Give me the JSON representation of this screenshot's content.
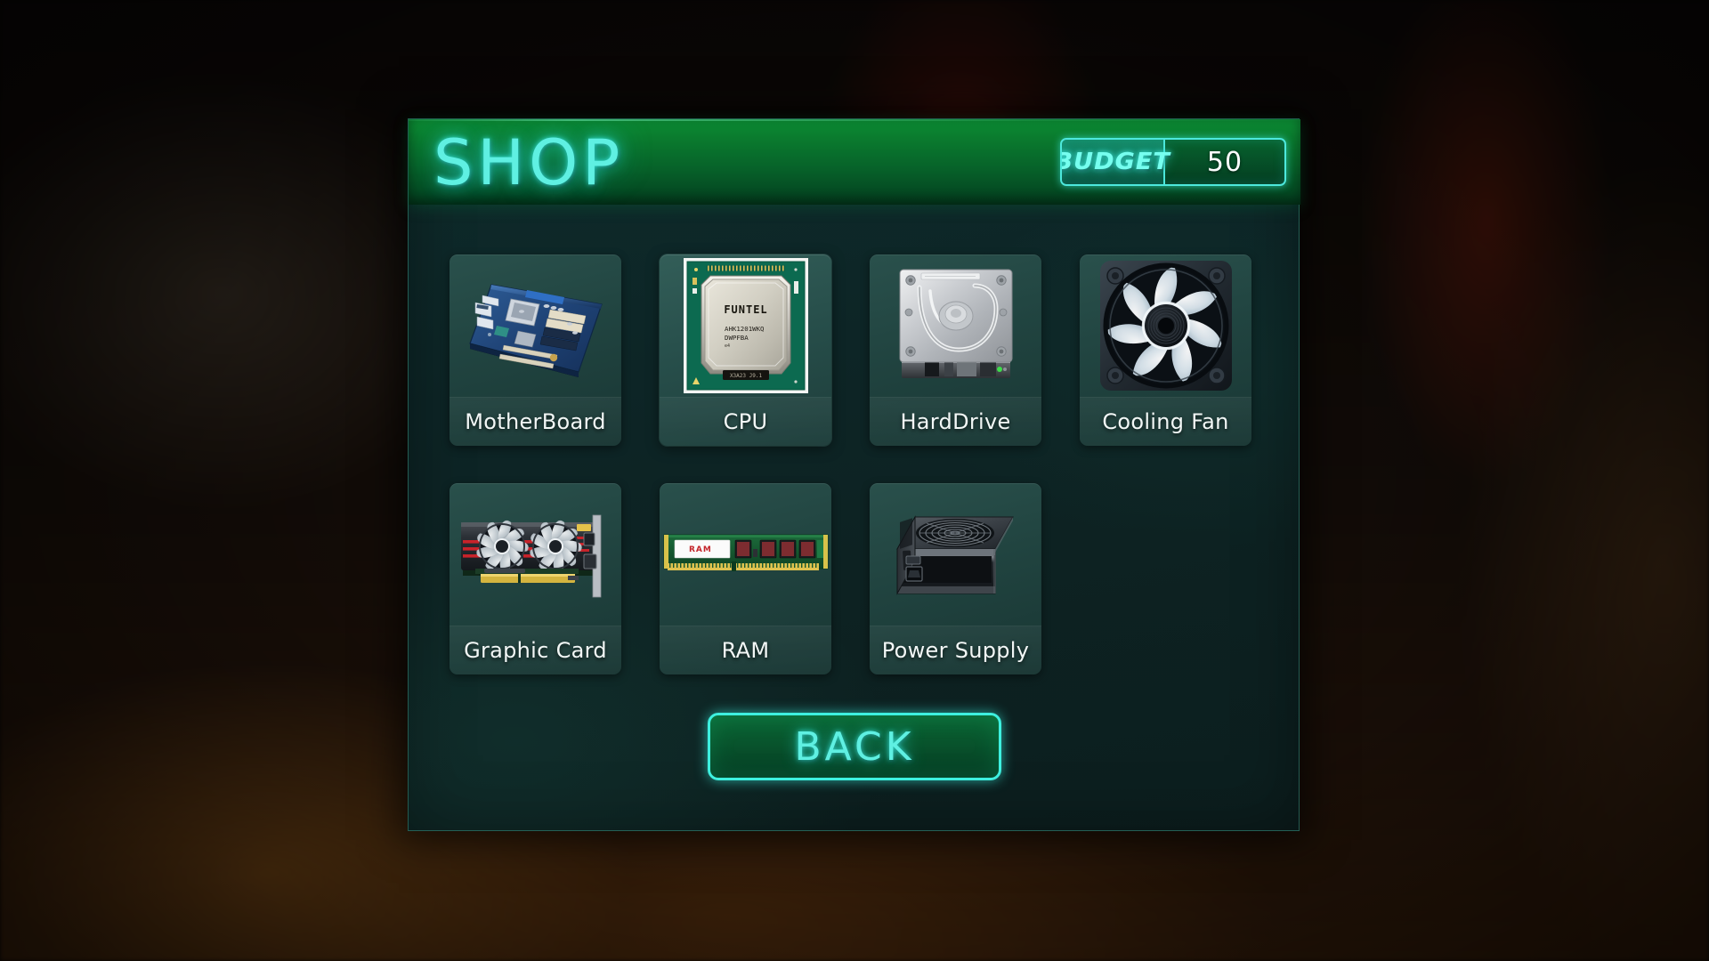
{
  "background": {
    "description": "blurred dark pc-case interior scene",
    "tones": [
      "#0a0706",
      "#2a1708",
      "#96160e"
    ]
  },
  "panel": {
    "header": {
      "title": "SHOP",
      "title_color": "#5ff0e2",
      "bar_color": "#0a7b2e"
    },
    "budget": {
      "label": "BUDGET",
      "value": "50",
      "label_color": "#76ffef",
      "value_color": "#fbfdfc",
      "border_color": "#4de8dc"
    }
  },
  "shop": {
    "items": [
      {
        "id": "motherboard",
        "label": "MotherBoard",
        "icon": "motherboard-icon",
        "selected": false
      },
      {
        "id": "cpu",
        "label": "CPU",
        "icon": "cpu-icon",
        "selected": true,
        "chip_text": {
          "brand": "FUNTEL",
          "line1": "AHK1201WKQ",
          "line2": "DWPFBA",
          "line3": "e4"
        }
      },
      {
        "id": "harddrive",
        "label": "HardDrive",
        "icon": "harddrive-icon",
        "selected": false
      },
      {
        "id": "coolingfan",
        "label": "Cooling Fan",
        "icon": "cooling-fan-icon",
        "selected": false
      },
      {
        "id": "graphiccard",
        "label": "Graphic Card",
        "icon": "graphic-card-icon",
        "selected": false
      },
      {
        "id": "ram",
        "label": "RAM",
        "icon": "ram-icon",
        "selected": false,
        "sticker_text": "RAM"
      },
      {
        "id": "powersupply",
        "label": "Power Supply",
        "icon": "power-supply-icon",
        "selected": false
      }
    ]
  },
  "footer": {
    "back_label": "BACK",
    "back_color": "#3ef0df"
  }
}
